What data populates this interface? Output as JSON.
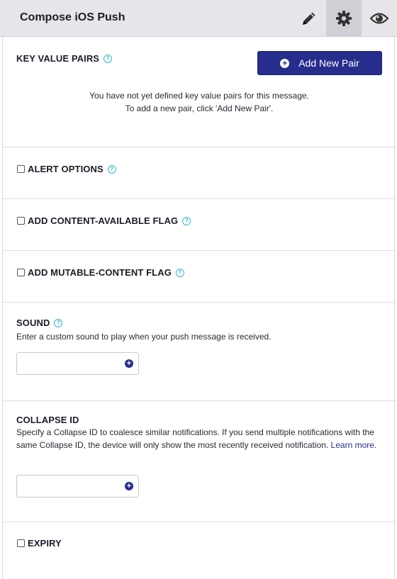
{
  "header": {
    "title": "Compose iOS Push",
    "icons": [
      "pencil-icon",
      "gear-icon",
      "eye-icon"
    ]
  },
  "key_value": {
    "title": "KEY VALUE PAIRS",
    "add_label": "Add New Pair",
    "empty_line1": "You have not yet defined key value pairs for this message.",
    "empty_line2": "To add a new pair, click 'Add New Pair'."
  },
  "alert": {
    "title": "ALERT OPTIONS"
  },
  "content_available": {
    "title": "ADD CONTENT-AVAILABLE FLAG"
  },
  "mutable_content": {
    "title": "ADD MUTABLE-CONTENT FLAG"
  },
  "sound": {
    "title": "SOUND",
    "description": "Enter a custom sound to play when your push message is received.",
    "value": ""
  },
  "collapse": {
    "title": "COLLAPSE ID",
    "description": "Specify a Collapse ID to coalesce similar notifications. If you send multiple notifications with the same Collapse ID, the device will only show the most recently received notification.",
    "link": "Learn more.",
    "value": ""
  },
  "expiry": {
    "title": "EXPIRY"
  },
  "help_glyph": "?",
  "colors": {
    "accent": "#262d8c",
    "help": "#36b6c9",
    "header_bg": "#e6e6ea"
  }
}
